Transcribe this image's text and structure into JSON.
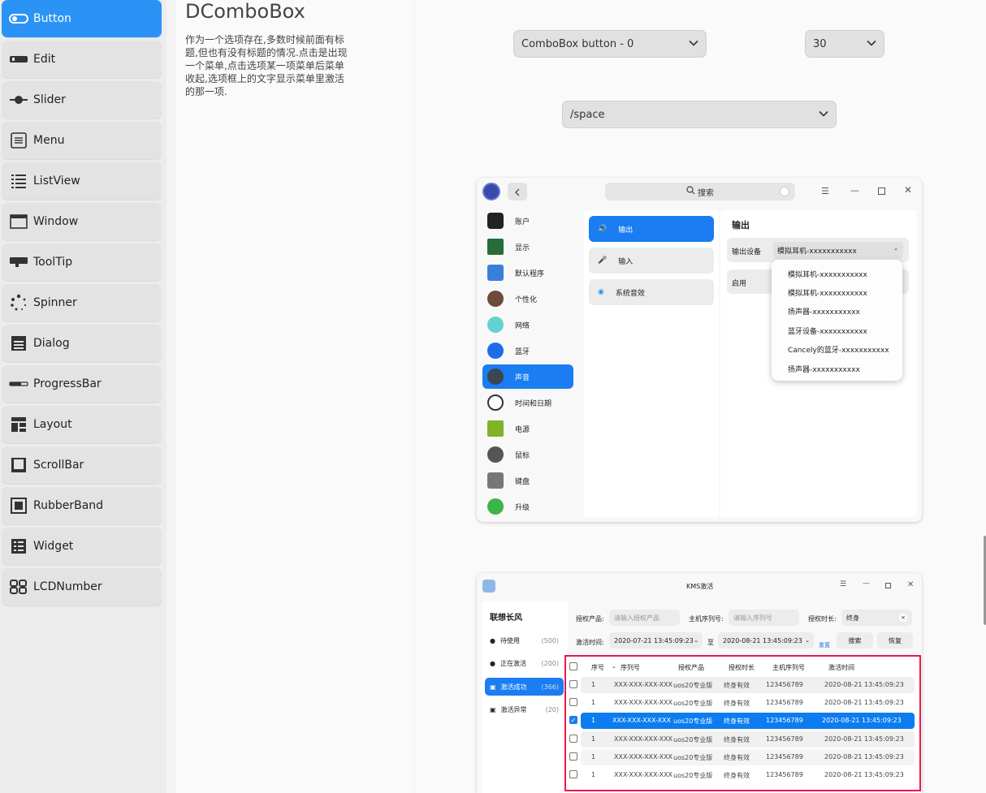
{
  "sidebar": {
    "items": [
      {
        "label": "Button",
        "icon": "toggle-icon"
      },
      {
        "label": "Edit",
        "icon": "edit-field-icon"
      },
      {
        "label": "Slider",
        "icon": "slider-icon"
      },
      {
        "label": "Menu",
        "icon": "menu-icon"
      },
      {
        "label": "ListView",
        "icon": "list-icon"
      },
      {
        "label": "Window",
        "icon": "window-icon"
      },
      {
        "label": "ToolTip",
        "icon": "tooltip-icon"
      },
      {
        "label": "Spinner",
        "icon": "spinner-icon"
      },
      {
        "label": "Dialog",
        "icon": "dialog-icon"
      },
      {
        "label": "ProgressBar",
        "icon": "progressbar-icon"
      },
      {
        "label": "Layout",
        "icon": "layout-icon"
      },
      {
        "label": "ScrollBar",
        "icon": "scrollbar-icon"
      },
      {
        "label": "RubberBand",
        "icon": "rubberband-icon"
      },
      {
        "label": "Widget",
        "icon": "widget-icon"
      },
      {
        "label": "LCDNumber",
        "icon": "lcd-number-icon"
      }
    ],
    "active_index": 0,
    "accent_color": "#2b93f6"
  },
  "content": {
    "title": "DComboBox",
    "description": "作为一个选项存在,多数时候前面有标题,但也有没有标题的情况.点击是出现一个菜单,点击选项某一项菜单后菜单收起,选项框上的文字显示菜单里激活的那一项."
  },
  "demo": {
    "combo1": "ComboBox button - 0",
    "combo2": "30",
    "combo3": "/space"
  },
  "settings_window": {
    "search_placeholder": "搜索",
    "nav": [
      "账户",
      "显示",
      "默认程序",
      "个性化",
      "网络",
      "蓝牙",
      "声音",
      "时间和日期",
      "电源",
      "鼠标",
      "键盘",
      "升级"
    ],
    "nav_active": "声音",
    "sub_nav": [
      "输出",
      "输入",
      "系统音效"
    ],
    "panel_title": "输出",
    "output_device_label": "输出设备",
    "output_device_value": "模拟耳机-xxxxxxxxxxx",
    "enable_label": "启用",
    "dropdown": [
      "模拟耳机-xxxxxxxxxxx",
      "模拟耳机-xxxxxxxxxxx",
      "扬声器-xxxxxxxxxxx",
      "蓝牙设备-xxxxxxxxxxx",
      "Cancely的蓝牙-xxxxxxxxxxx",
      "扬声器-xxxxxxxxxxx"
    ]
  },
  "kms_window": {
    "title": "KMS激活",
    "group_title": "联想长风",
    "groups": [
      {
        "label": "待使用",
        "count": "(500)"
      },
      {
        "label": "正在激活",
        "count": "(200)"
      },
      {
        "label": "激活成功",
        "count": "(366)"
      },
      {
        "label": "激活异常",
        "count": "(20)"
      }
    ],
    "product_label": "授权产品:",
    "product_placeholder": "请输入授权产品",
    "serial_label": "主机序列号:",
    "serial_placeholder": "请输入序列号",
    "duration_label": "授权时长:",
    "duration_value": "终身",
    "time_label": "激活时间:",
    "time_from": "2020-07-21 13:45:09:23",
    "to": "至",
    "time_to": "2020-08-21 13:45:09:23",
    "reset": "重置",
    "search_btn": "搜索",
    "restore_btn": "恢复",
    "headers": [
      "序号",
      "序列号",
      "授权产品",
      "授权时长",
      "主机序列号",
      "激活时间"
    ],
    "rows": [
      [
        "1",
        "XXX-XXX-XXX-XXX",
        "uos20专业版",
        "终身有效",
        "123456789",
        "2020-08-21  13:45:09:23"
      ],
      [
        "1",
        "XXX-XXX-XXX-XXX",
        "uos20专业版",
        "终身有效",
        "123456789",
        "2020-08-21  13:45:09:23"
      ],
      [
        "1",
        "XXX-XXX-XXX-XXX",
        "uos20专业版",
        "终身有效",
        "123456789",
        "2020-08-21  13:45:09:23"
      ],
      [
        "1",
        "XXX-XXX-XXX-XXX",
        "uos20专业版",
        "终身有效",
        "123456789",
        "2020-08-21  13:45:09:23"
      ],
      [
        "1",
        "XXX-XXX-XXX-XXX",
        "uos20专业版",
        "终身有效",
        "123456789",
        "2020-08-21  13:45:09:23"
      ],
      [
        "1",
        "XXX-XXX-XXX-XXX",
        "uos20专业版",
        "终身有效",
        "123456789",
        "2020-08-21  13:45:09:23"
      ]
    ],
    "selected_row": 2,
    "highlight_color": "#e8194a"
  }
}
